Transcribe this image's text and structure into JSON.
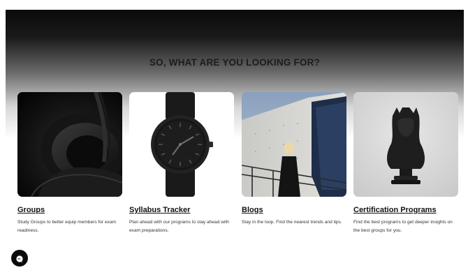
{
  "section": {
    "heading": "SO, WHAT ARE YOU LOOKING FOR?"
  },
  "cards": [
    {
      "title": "Groups",
      "description": "Study Groups to better equip members for exam readiness.",
      "image": "black-headphones-image"
    },
    {
      "title": "Syllabus Tracker",
      "description": "Plan ahead with our programs to stay ahead with exam preparations.",
      "image": "black-wristwatch-image"
    },
    {
      "title": "Blogs",
      "description": "Stay in the loop. Find the nearest trends and tips.",
      "image": "woman-by-building-image"
    },
    {
      "title": "Certification Programs",
      "description": "Find the best programs to get deeper insights on the best groups for you.",
      "image": "black-bust-sculpture-image"
    }
  ],
  "chat": {
    "icon": "chat-icon"
  }
}
